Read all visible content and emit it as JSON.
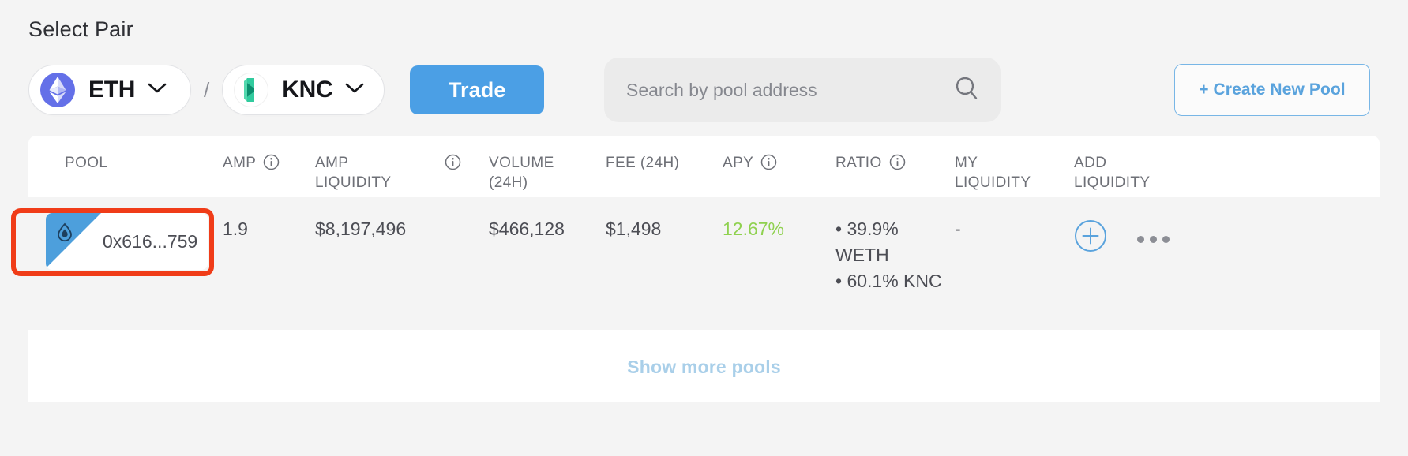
{
  "section": {
    "title": "Select Pair"
  },
  "pair_selector": {
    "token_a": {
      "symbol": "ETH",
      "logo": "eth-logo-icon",
      "chevron": "chevron-down-icon"
    },
    "separator": "/",
    "token_b": {
      "symbol": "KNC",
      "logo": "knc-logo-icon",
      "chevron": "chevron-down-icon"
    },
    "trade_label": "Trade"
  },
  "search": {
    "placeholder": "Search by pool address",
    "value": "",
    "icon": "search-icon"
  },
  "create_pool": {
    "label": "+ Create New Pool"
  },
  "table": {
    "headers": [
      {
        "key": "pool",
        "label": "POOL",
        "info": false
      },
      {
        "key": "amp",
        "label": "AMP",
        "info": true
      },
      {
        "key": "ampliq",
        "label": "AMP\nLIQUIDITY",
        "info": true
      },
      {
        "key": "volume",
        "label": "VOLUME\n(24H)",
        "info": false
      },
      {
        "key": "fee",
        "label": "FEE (24H)",
        "info": false
      },
      {
        "key": "apy",
        "label": "APY",
        "info": true
      },
      {
        "key": "ratio",
        "label": "RATIO",
        "info": true
      },
      {
        "key": "myliq",
        "label": "MY\nLIQUIDITY",
        "info": false
      },
      {
        "key": "addliq",
        "label": "ADD\nLIQUIDITY",
        "info": false
      }
    ],
    "rows": [
      {
        "pool_address": "0x616...759",
        "pool_badge_icon": "droplet-icon",
        "copy_icon": "copy-icon",
        "amp": "1.9",
        "amp_liquidity": "$8,197,496",
        "volume_24h": "$466,128",
        "fee_24h": "$1,498",
        "apy": "12.67%",
        "ratio_line_1": "• 39.9% WETH",
        "ratio_line_2": "• 60.1% KNC",
        "my_liquidity": "-",
        "add_liquidity_icon": "plus-circle-icon",
        "more_menu_icon": "more-horizontal-icon"
      }
    ]
  },
  "footer": {
    "show_more_label": "Show more pools"
  },
  "colors": {
    "accent_blue": "#4b9fe5",
    "link_blue": "#5aa3dd",
    "apy_green": "#8fd14f",
    "highlight_red": "#f03c18",
    "page_bg": "#f4f4f4",
    "panel_bg": "#ffffff"
  }
}
